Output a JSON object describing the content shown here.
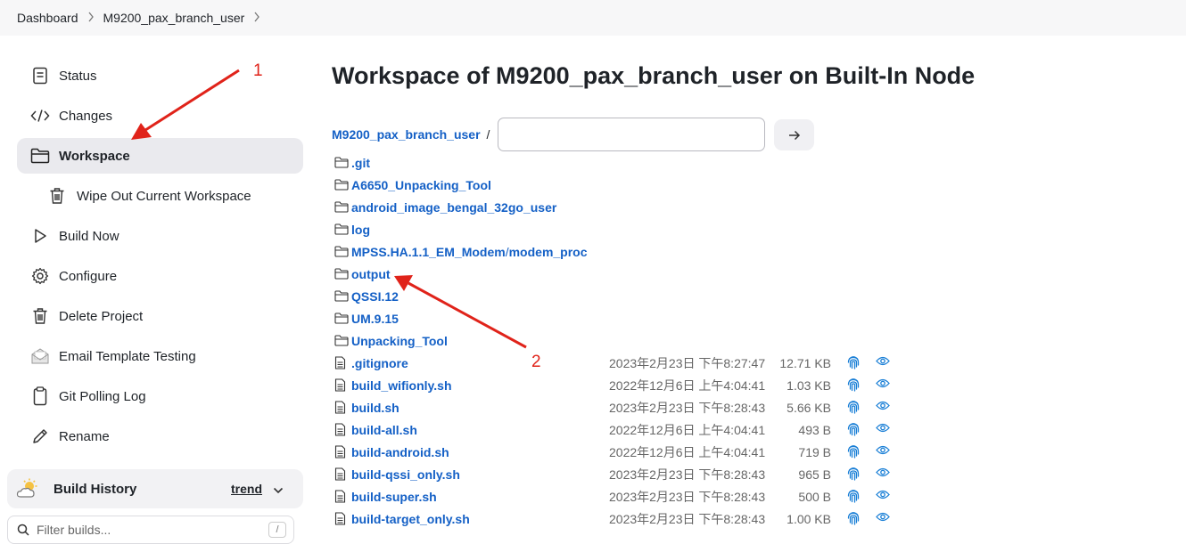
{
  "breadcrumb": {
    "items": [
      "Dashboard",
      "M9200_pax_branch_user"
    ]
  },
  "sidebar": {
    "items": [
      {
        "label": "Status",
        "icon": "status-icon"
      },
      {
        "label": "Changes",
        "icon": "code-icon"
      },
      {
        "label": "Workspace",
        "icon": "folder-icon",
        "active": true
      },
      {
        "label": "Wipe Out Current Workspace",
        "icon": "trash-icon"
      },
      {
        "label": "Build Now",
        "icon": "play-icon"
      },
      {
        "label": "Configure",
        "icon": "gear-icon"
      },
      {
        "label": "Delete Project",
        "icon": "trash-icon"
      },
      {
        "label": "Email Template Testing",
        "icon": "envelope-icon"
      },
      {
        "label": "Git Polling Log",
        "icon": "clipboard-icon"
      },
      {
        "label": "Rename",
        "icon": "pencil-icon"
      }
    ],
    "build_history": {
      "label": "Build History",
      "trend": "trend"
    },
    "filter": {
      "placeholder": "Filter builds...",
      "shortcut": "/"
    }
  },
  "main": {
    "title": "Workspace of M9200_pax_branch_user on Built-In Node",
    "path_link": "M9200_pax_branch_user",
    "path_sep": "/",
    "folders": [
      {
        "name": ".git"
      },
      {
        "name": "A6650_Unpacking_Tool"
      },
      {
        "name": "android_image_bengal_32go_user"
      },
      {
        "name": "log"
      },
      {
        "name": "MPSS.HA.1.1_EM_Modem",
        "suffix": "/",
        "suffix2": "modem_proc"
      },
      {
        "name": "output"
      },
      {
        "name": "QSSI.12"
      },
      {
        "name": "UM.9.15"
      },
      {
        "name": "Unpacking_Tool"
      }
    ],
    "files": [
      {
        "name": ".gitignore",
        "date": "2023年2月23日 下午8:27:47",
        "size": "12.71 KB"
      },
      {
        "name": "build_wifionly.sh",
        "date": "2022年12月6日 上午4:04:41",
        "size": "1.03 KB"
      },
      {
        "name": "build.sh",
        "date": "2023年2月23日 下午8:28:43",
        "size": "5.66 KB"
      },
      {
        "name": "build-all.sh",
        "date": "2022年12月6日 上午4:04:41",
        "size": "493 B"
      },
      {
        "name": "build-android.sh",
        "date": "2022年12月6日 上午4:04:41",
        "size": "719 B"
      },
      {
        "name": "build-qssi_only.sh",
        "date": "2023年2月23日 下午8:28:43",
        "size": "965 B"
      },
      {
        "name": "build-super.sh",
        "date": "2023年2月23日 下午8:28:43",
        "size": "500 B"
      },
      {
        "name": "build-target_only.sh",
        "date": "2023年2月23日 下午8:28:43",
        "size": "1.00 KB"
      }
    ]
  },
  "annotations": {
    "label1": "1",
    "label2": "2",
    "color": "#e0231a"
  },
  "colors": {
    "link": "#1460c6",
    "fingerprint": "#1a7fd6",
    "active_bg": "#eaeaee"
  }
}
